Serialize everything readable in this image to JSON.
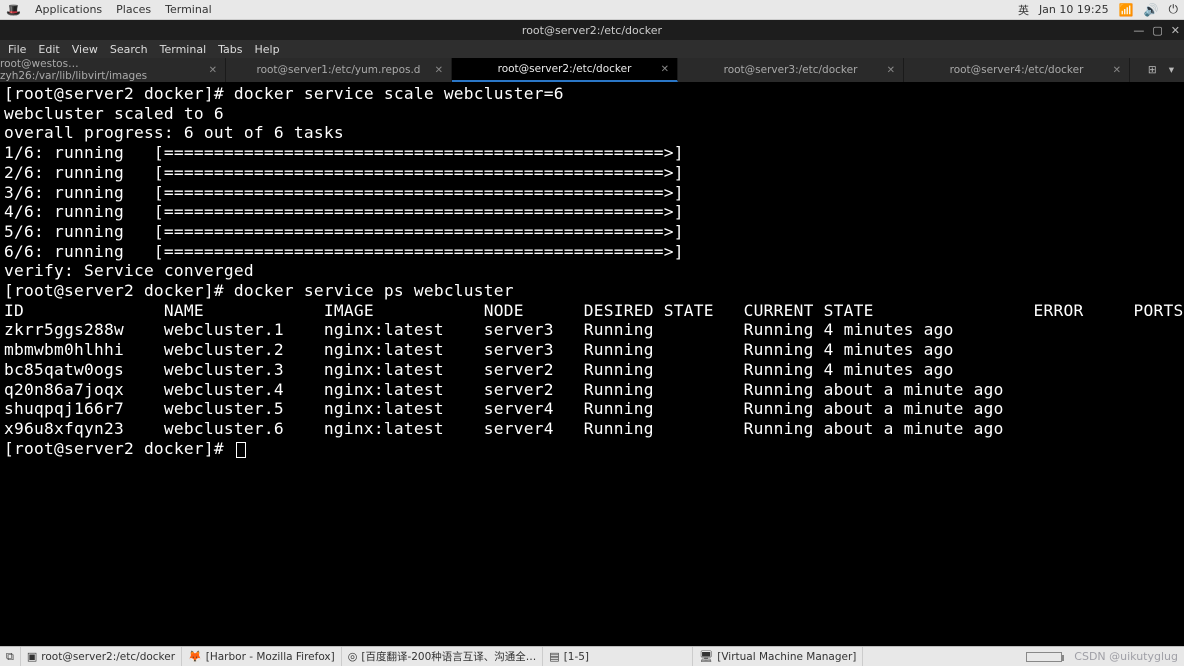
{
  "top_bar": {
    "apps": "Applications",
    "places": "Places",
    "terminal": "Terminal",
    "lang": "英",
    "date": "Jan 10  19:25"
  },
  "window": {
    "title": "root@server2:/etc/docker"
  },
  "menu": {
    "file": "File",
    "edit": "Edit",
    "view": "View",
    "search": "Search",
    "terminal": "Terminal",
    "tabs": "Tabs",
    "help": "Help"
  },
  "tabs": [
    {
      "label": "root@westos…zyh26:/var/lib/libvirt/images",
      "active": false
    },
    {
      "label": "root@server1:/etc/yum.repos.d",
      "active": false
    },
    {
      "label": "root@server2:/etc/docker",
      "active": true
    },
    {
      "label": "root@server3:/etc/docker",
      "active": false
    },
    {
      "label": "root@server4:/etc/docker",
      "active": false
    }
  ],
  "terminal": {
    "prompt": "[root@server2 docker]# ",
    "cmd_scale": "docker service scale webcluster=6",
    "scaled_line": "webcluster scaled to 6",
    "progress_line": "overall progress: 6 out of 6 tasks",
    "running_lines": [
      "1/6: running   [==================================================>] ",
      "2/6: running   [==================================================>] ",
      "3/6: running   [==================================================>] ",
      "4/6: running   [==================================================>] ",
      "5/6: running   [==================================================>] ",
      "6/6: running   [==================================================>] "
    ],
    "verify_line": "verify: Service converged",
    "cmd_ps": "docker service ps webcluster",
    "ps_header": "ID              NAME            IMAGE           NODE      DESIRED STATE   CURRENT STATE                ERROR     PORTS",
    "ps_rows": [
      "zkrr5ggs288w    webcluster.1    nginx:latest    server3   Running         Running 4 minutes ago",
      "mbmwbm0hlhhi    webcluster.2    nginx:latest    server3   Running         Running 4 minutes ago",
      "bc85qatw0ogs    webcluster.3    nginx:latest    server2   Running         Running 4 minutes ago",
      "q20n86a7joqx    webcluster.4    nginx:latest    server2   Running         Running about a minute ago",
      "shuqpqj166r7    webcluster.5    nginx:latest    server4   Running         Running about a minute ago",
      "x96u8xfqyn23    webcluster.6    nginx:latest    server4   Running         Running about a minute ago"
    ]
  },
  "taskbar": {
    "items": [
      {
        "icon": "⧉",
        "label": ""
      },
      {
        "icon": "▣",
        "label": "root@server2:/etc/docker"
      },
      {
        "icon": "🦊",
        "label": "[Harbor - Mozilla Firefox]"
      },
      {
        "icon": "◎",
        "label": "[百度翻译-200种语言互译、沟通全…"
      },
      {
        "icon": "▤",
        "label": "[1-5]"
      },
      {
        "icon": "🖥",
        "label": "[Virtual Machine Manager]"
      }
    ],
    "watermark": "CSDN @uikutyglug"
  }
}
